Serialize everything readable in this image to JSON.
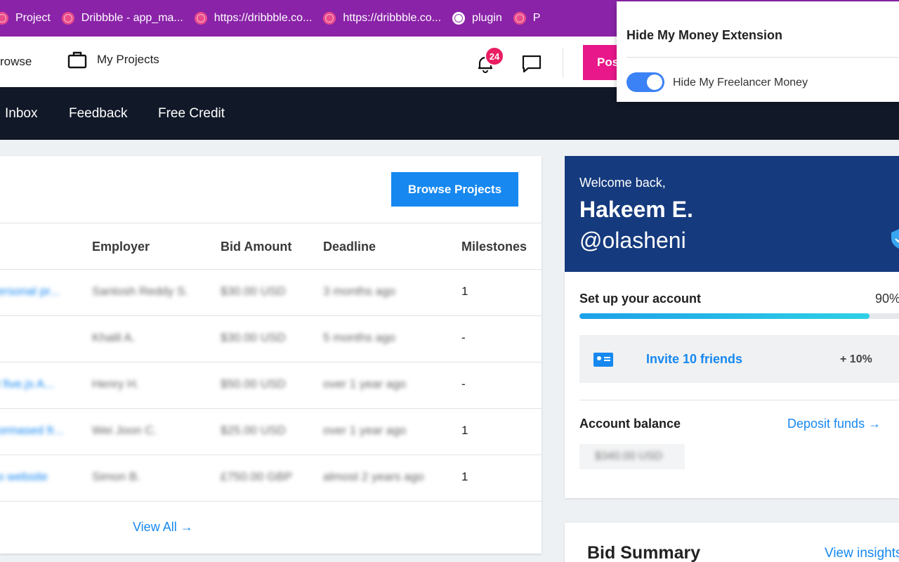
{
  "bookmarks": [
    {
      "label": "Project",
      "icon": "dribbble-icon"
    },
    {
      "label": "Dribbble - app_ma...",
      "icon": "dribbble-icon"
    },
    {
      "label": "https://dribbble.co...",
      "icon": "dribbble-icon"
    },
    {
      "label": "https://dribbble.co...",
      "icon": "dribbble-icon"
    },
    {
      "label": "plugin",
      "icon": "globe-icon"
    },
    {
      "label": "P",
      "icon": "dribbble-icon"
    }
  ],
  "topnav": {
    "browse": "rowse",
    "my_projects": "My Projects",
    "notification_count": "24",
    "post_label": "Pos"
  },
  "subnav": {
    "inbox": "Inbox",
    "feedback": "Feedback",
    "free_credit": "Free Credit"
  },
  "popup": {
    "title": "Hide My Money Extension",
    "toggle_label": "Hide My Freelancer Money",
    "toggle_on": true
  },
  "projects": {
    "browse_button": "Browse Projects",
    "headers": {
      "employer": "Employer",
      "bid_amount": "Bid Amount",
      "deadline": "Deadline",
      "milestones": "Milestones"
    },
    "rows": [
      {
        "project": "ersonal pr...",
        "employer": "Santosh Reddy S.",
        "bid": "$30.00 USD",
        "deadline": "3 months ago",
        "milestones": "1"
      },
      {
        "project": "",
        "employer": "Khalil A.",
        "bid": "$30.00 USD",
        "deadline": "5 months ago",
        "milestones": "-"
      },
      {
        "project": "l five.js A...",
        "employer": "Henry H.",
        "bid": "$50.00 USD",
        "deadline": "over 1 year ago",
        "milestones": "-"
      },
      {
        "project": "ormased fr...",
        "employer": "Wei Joon C.",
        "bid": "$25.00 USD",
        "deadline": "over 1 year ago",
        "milestones": "1"
      },
      {
        "project": "o website",
        "employer": "Simon B.",
        "bid": "£750.00 GBP",
        "deadline": "almost 2 years ago",
        "milestones": "1"
      }
    ],
    "view_all": "View All →"
  },
  "welcome": {
    "greeting": "Welcome back,",
    "name": "Hakeem E.",
    "handle": "@olasheni"
  },
  "account": {
    "setup_label": "Set up your account",
    "progress_text": "90%",
    "progress": 0.9,
    "invite_label": "Invite 10 friends",
    "invite_bonus": "+ 10%",
    "balance_label": "Account balance",
    "deposit_label": "Deposit funds →",
    "balance_value": "$340.00 USD"
  },
  "bid_summary": {
    "title": "Bid Summary",
    "insights": "View insights"
  },
  "colors": {
    "bookmark_bar": "#8a23a8",
    "subnav": "#111827",
    "primary": "#1688f0",
    "post": "#e8178a",
    "welcome": "#153a7e"
  }
}
